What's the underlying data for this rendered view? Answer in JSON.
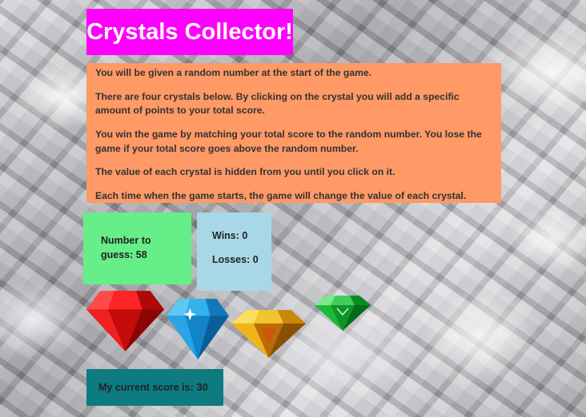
{
  "header": {
    "title": "Crystals Collector!"
  },
  "instructions": {
    "paragraphs": [
      "You will be given a random number at the start of the game.",
      "There are four crystals below. By clicking on the crystal you will add a specific amount of points to your total score.",
      "You win the game by matching your total score to the random number. You lose the game if your total score goes above the random number.",
      "The value of each crystal is hidden from you until you click on it.",
      "Each time when the game starts, the game will change the value of each crystal."
    ]
  },
  "target": {
    "label": "Number to guess:",
    "value": "58"
  },
  "stats": {
    "wins_label": "Wins:",
    "wins": "0",
    "losses_label": "Losses:",
    "losses": "0"
  },
  "crystals": [
    {
      "icon": "red-crystal-icon",
      "color": "#e81818"
    },
    {
      "icon": "blue-crystal-icon",
      "color": "#1aa0e0"
    },
    {
      "icon": "yellow-crystal-icon",
      "color": "#f0b010"
    },
    {
      "icon": "green-crystal-icon",
      "color": "#12b830"
    }
  ],
  "score": {
    "label": "My current score is:",
    "value": "30"
  },
  "colors": {
    "title_bg": "#ff00ff",
    "instructions_bg": "#ff9966",
    "target_bg": "#66ee88",
    "stats_bg": "#a8d8e8",
    "score_bg": "#0d7b80"
  }
}
